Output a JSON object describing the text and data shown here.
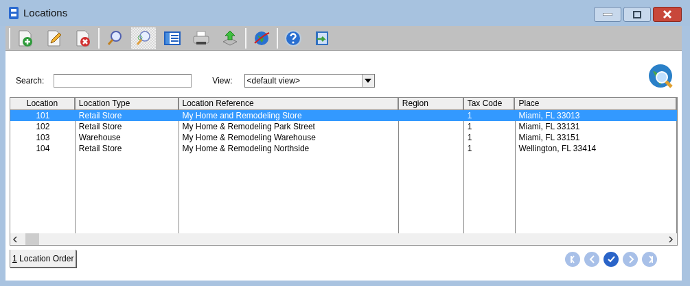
{
  "window": {
    "title": "Locations"
  },
  "toolbar": [
    [
      {
        "kind": "new",
        "selected": false
      },
      {
        "kind": "edit",
        "selected": false
      },
      {
        "kind": "delete",
        "selected": false
      }
    ],
    [
      {
        "kind": "search",
        "selected": false
      },
      {
        "kind": "find",
        "selected": true
      },
      {
        "kind": "list",
        "selected": false
      },
      {
        "kind": "print",
        "selected": false
      },
      {
        "kind": "export",
        "selected": false
      }
    ],
    [
      {
        "kind": "globe",
        "selected": false
      }
    ],
    [
      {
        "kind": "help",
        "selected": false
      },
      {
        "kind": "exit",
        "selected": false
      }
    ]
  ],
  "filter": {
    "search_label": "Search:",
    "view_label": "View:",
    "view_value": "<default view>"
  },
  "table": {
    "columns": [
      {
        "label": "Location"
      },
      {
        "label": "Location Type"
      },
      {
        "label": "Location Reference"
      },
      {
        "label": "Region"
      },
      {
        "label": "Tax Code"
      },
      {
        "label": "Place"
      }
    ],
    "rows": [
      {
        "selected": true,
        "cells": [
          "101",
          "Retail Store",
          "My Home and Remodeling Store",
          "",
          "1",
          "Miami, FL 33013"
        ]
      },
      {
        "selected": false,
        "cells": [
          "102",
          "Retail Store",
          "My Home & Remodeling Park Street",
          "",
          "1",
          "Miami, FL 33131"
        ]
      },
      {
        "selected": false,
        "cells": [
          "103",
          "Warehouse",
          "My Home & Remodeling Warehouse",
          "",
          "1",
          "Miami, FL 33151"
        ]
      },
      {
        "selected": false,
        "cells": [
          "104",
          "Retail Store",
          "My Home & Remodeling Northside",
          "",
          "1",
          "Wellington, FL 33414"
        ]
      }
    ]
  },
  "tabs": [
    {
      "hotkey": "1",
      "label": "Location Order",
      "selected": true
    }
  ],
  "navigation": [
    {
      "kind": "first",
      "disabled": true
    },
    {
      "kind": "previous",
      "disabled": true
    },
    {
      "kind": "confirm",
      "disabled": false
    },
    {
      "kind": "next",
      "disabled": true
    },
    {
      "kind": "last",
      "disabled": true
    }
  ]
}
